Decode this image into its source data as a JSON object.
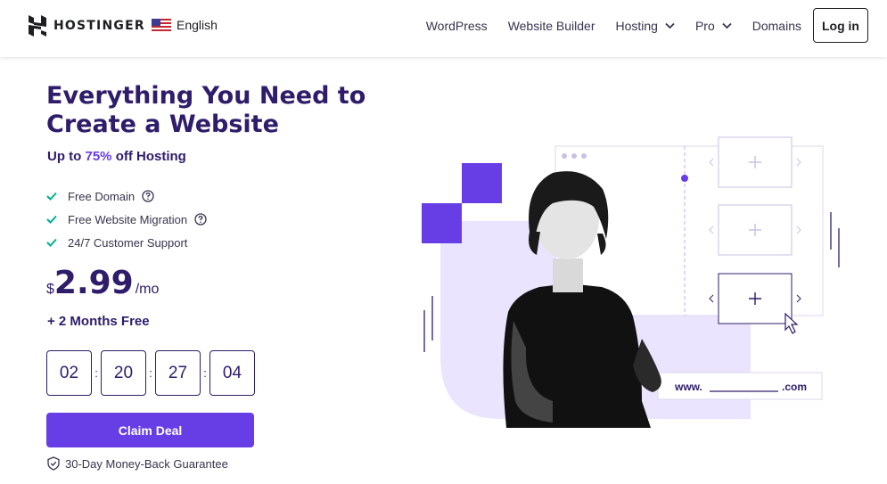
{
  "header": {
    "logo_text": "HOSTINGER",
    "language": "English",
    "nav": [
      {
        "label": "WordPress",
        "dropdown": false
      },
      {
        "label": "Website Builder",
        "dropdown": false
      },
      {
        "label": "Hosting",
        "dropdown": true
      },
      {
        "label": "Pro",
        "dropdown": true
      },
      {
        "label": "Domains",
        "dropdown": false
      }
    ],
    "login_label": "Log in"
  },
  "hero": {
    "title": "Everything You Need to Create a Website",
    "subtitle_pre": "Up to ",
    "subtitle_accent": "75%",
    "subtitle_post": " off Hosting",
    "features": [
      {
        "label": "Free Domain",
        "help": true
      },
      {
        "label": "Free Website Migration",
        "help": true
      },
      {
        "label": "24/7 Customer Support",
        "help": false
      }
    ],
    "currency": "$",
    "price": "2.99",
    "per": "/mo",
    "bonus": "+ 2 Months Free",
    "timer": [
      "02",
      "20",
      "27",
      "04"
    ],
    "timer_separator": ":",
    "cta_label": "Claim Deal",
    "guarantee": "30-Day Money-Back Guarantee"
  },
  "illustration": {
    "url_prefix": "www.",
    "url_suffix": ".com"
  },
  "colors": {
    "brand": "#673de6",
    "heading": "#2f1c6a",
    "check": "#00b090",
    "panel": "#ebe4ff"
  }
}
